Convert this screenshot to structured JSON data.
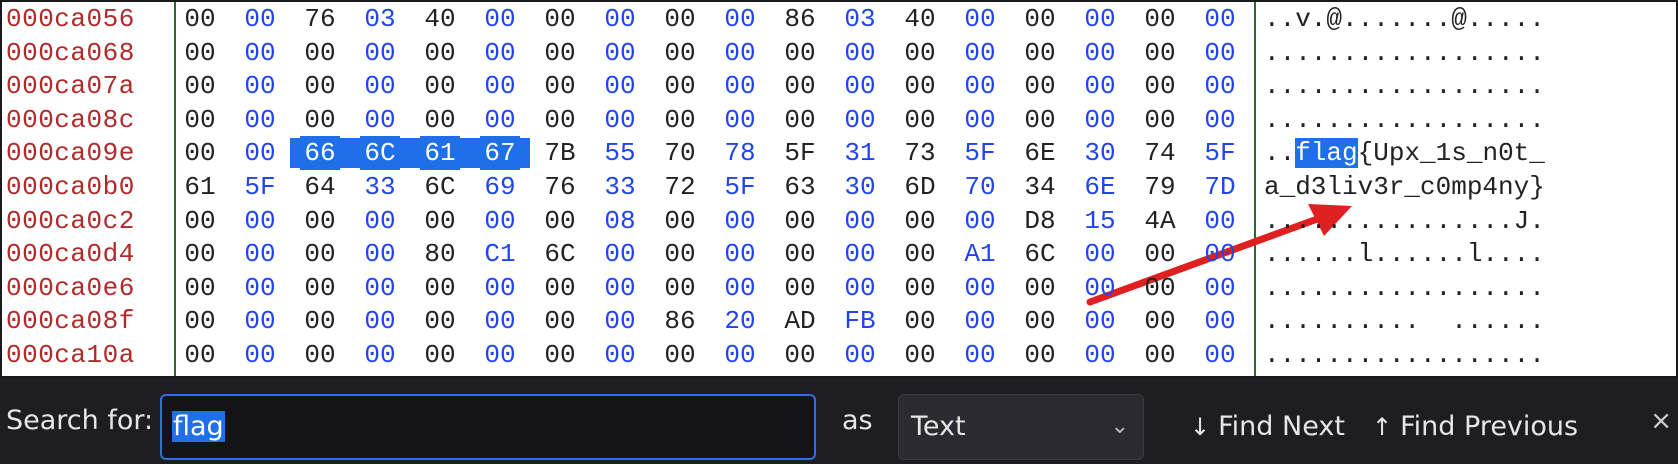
{
  "hexview": {
    "rows": [
      {
        "addr": "000ca056",
        "bytes": [
          "00",
          "00",
          "76",
          "03",
          "40",
          "00",
          "00",
          "00",
          "00",
          "00",
          "86",
          "03",
          "40",
          "00",
          "00",
          "00",
          "00",
          "00"
        ],
        "ascii": "..v.@.......@....."
      },
      {
        "addr": "000ca068",
        "bytes": [
          "00",
          "00",
          "00",
          "00",
          "00",
          "00",
          "00",
          "00",
          "00",
          "00",
          "00",
          "00",
          "00",
          "00",
          "00",
          "00",
          "00",
          "00"
        ],
        "ascii": ".................."
      },
      {
        "addr": "000ca07a",
        "bytes": [
          "00",
          "00",
          "00",
          "00",
          "00",
          "00",
          "00",
          "00",
          "00",
          "00",
          "00",
          "00",
          "00",
          "00",
          "00",
          "00",
          "00",
          "00"
        ],
        "ascii": ".................."
      },
      {
        "addr": "000ca08c",
        "bytes": [
          "00",
          "00",
          "00",
          "00",
          "00",
          "00",
          "00",
          "00",
          "00",
          "00",
          "00",
          "00",
          "00",
          "00",
          "00",
          "00",
          "00",
          "00"
        ],
        "ascii": ".................."
      },
      {
        "addr": "000ca09e",
        "bytes": [
          "00",
          "00",
          "66",
          "6C",
          "61",
          "67",
          "7B",
          "55",
          "70",
          "78",
          "5F",
          "31",
          "73",
          "5F",
          "6E",
          "30",
          "74",
          "5F"
        ],
        "ascii_pre": "..",
        "ascii_hl": "flag",
        "ascii_post": "{Upx_1s_n0t_"
      },
      {
        "addr": "000ca0b0",
        "bytes": [
          "61",
          "5F",
          "64",
          "33",
          "6C",
          "69",
          "76",
          "33",
          "72",
          "5F",
          "63",
          "30",
          "6D",
          "70",
          "34",
          "6E",
          "79",
          "7D"
        ],
        "ascii": "a_d3liv3r_c0mp4ny}"
      },
      {
        "addr": "000ca0c2",
        "bytes": [
          "00",
          "00",
          "00",
          "00",
          "00",
          "00",
          "00",
          "08",
          "00",
          "00",
          "00",
          "00",
          "00",
          "00",
          "D8",
          "15",
          "4A",
          "00"
        ],
        "ascii": "................J."
      },
      {
        "addr": "000ca0d4",
        "bytes": [
          "00",
          "00",
          "00",
          "00",
          "80",
          "C1",
          "6C",
          "00",
          "00",
          "00",
          "00",
          "00",
          "00",
          "A1",
          "6C",
          "00",
          "00",
          "00"
        ],
        "ascii": "......l......l...."
      },
      {
        "addr": "000ca0e6",
        "bytes": [
          "00",
          "00",
          "00",
          "00",
          "00",
          "00",
          "00",
          "00",
          "00",
          "00",
          "00",
          "00",
          "00",
          "00",
          "00",
          "00",
          "00",
          "00"
        ],
        "ascii": ".................."
      },
      {
        "addr": "000ca08f",
        "bytes": [
          "00",
          "00",
          "00",
          "00",
          "00",
          "00",
          "00",
          "00",
          "86",
          "20",
          "AD",
          "FB",
          "00",
          "00",
          "00",
          "00",
          "00",
          "00"
        ],
        "ascii": "..........  ......"
      },
      {
        "addr": "000ca10a",
        "bytes": [
          "00",
          "00",
          "00",
          "00",
          "00",
          "00",
          "00",
          "00",
          "00",
          "00",
          "00",
          "00",
          "00",
          "00",
          "00",
          "00",
          "00",
          "00"
        ],
        "ascii": ".................."
      }
    ],
    "selected_row": 4,
    "selected_bytes": [
      2,
      3,
      4,
      5
    ],
    "annotation_color": "#e02020"
  },
  "findbar": {
    "label": "Search for:",
    "query": "flag",
    "as_label": "as",
    "mode": "Text",
    "find_next": "Find Next",
    "find_previous": "Find Previous",
    "close": "×",
    "icons": {
      "next": "arrow-down-icon",
      "prev": "arrow-up-icon",
      "close": "close-icon",
      "chevron": "chevron-down-icon"
    }
  }
}
